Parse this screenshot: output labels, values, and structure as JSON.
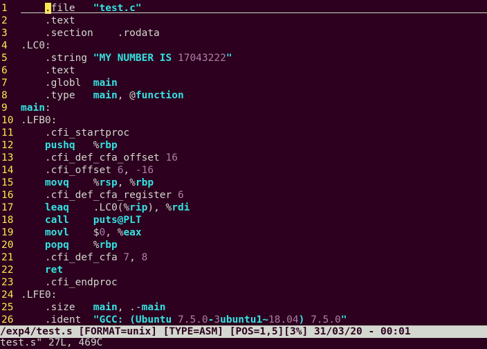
{
  "editor": {
    "lines": [
      {
        "num": "1",
        "segs": [
          {
            "t": "    ",
            "c": "k"
          },
          {
            "t": ".",
            "c": "cursor"
          },
          {
            "t": "file   ",
            "c": "k"
          },
          {
            "t": "\"test.c\"",
            "c": "sq"
          }
        ]
      },
      {
        "num": "2",
        "segs": [
          {
            "t": "    .text",
            "c": "k"
          }
        ]
      },
      {
        "num": "3",
        "segs": [
          {
            "t": "    .section    .rodata",
            "c": "k"
          }
        ]
      },
      {
        "num": "4",
        "segs": [
          {
            "t": ".LC0:",
            "c": "k"
          }
        ]
      },
      {
        "num": "5",
        "segs": [
          {
            "t": "    .string ",
            "c": "k"
          },
          {
            "t": "\"MY NUMBER IS ",
            "c": "sq"
          },
          {
            "t": "17043222",
            "c": "s"
          },
          {
            "t": "\"",
            "c": "sq"
          }
        ]
      },
      {
        "num": "6",
        "segs": [
          {
            "t": "    .text",
            "c": "k"
          }
        ]
      },
      {
        "num": "7",
        "segs": [
          {
            "t": "    .globl  ",
            "c": "k"
          },
          {
            "t": "main",
            "c": "kw"
          }
        ]
      },
      {
        "num": "8",
        "segs": [
          {
            "t": "    .type   ",
            "c": "k"
          },
          {
            "t": "main",
            "c": "kw"
          },
          {
            "t": ", @",
            "c": "k"
          },
          {
            "t": "function",
            "c": "kw"
          }
        ]
      },
      {
        "num": "9",
        "segs": [
          {
            "t": "main",
            "c": "kw"
          },
          {
            "t": ":",
            "c": "k"
          }
        ]
      },
      {
        "num": "10",
        "segs": [
          {
            "t": ".LFB0:",
            "c": "k"
          }
        ]
      },
      {
        "num": "11",
        "segs": [
          {
            "t": "    .cfi_startproc",
            "c": "k"
          }
        ]
      },
      {
        "num": "12",
        "segs": [
          {
            "t": "    ",
            "c": "k"
          },
          {
            "t": "pushq",
            "c": "kw"
          },
          {
            "t": "   %",
            "c": "k"
          },
          {
            "t": "rbp",
            "c": "kw"
          }
        ]
      },
      {
        "num": "13",
        "segs": [
          {
            "t": "    .cfi_def_cfa_offset ",
            "c": "k"
          },
          {
            "t": "16",
            "c": "s"
          }
        ]
      },
      {
        "num": "14",
        "segs": [
          {
            "t": "    .cfi_offset ",
            "c": "k"
          },
          {
            "t": "6",
            "c": "s"
          },
          {
            "t": ", ",
            "c": "k"
          },
          {
            "t": "-16",
            "c": "s"
          }
        ]
      },
      {
        "num": "15",
        "segs": [
          {
            "t": "    ",
            "c": "k"
          },
          {
            "t": "movq",
            "c": "kw"
          },
          {
            "t": "    %",
            "c": "k"
          },
          {
            "t": "rsp",
            "c": "kw"
          },
          {
            "t": ", %",
            "c": "k"
          },
          {
            "t": "rbp",
            "c": "kw"
          }
        ]
      },
      {
        "num": "16",
        "segs": [
          {
            "t": "    .cfi_def_cfa_register ",
            "c": "k"
          },
          {
            "t": "6",
            "c": "s"
          }
        ]
      },
      {
        "num": "17",
        "segs": [
          {
            "t": "    ",
            "c": "k"
          },
          {
            "t": "leaq",
            "c": "kw"
          },
          {
            "t": "    .LC0(%",
            "c": "k"
          },
          {
            "t": "rip",
            "c": "kw"
          },
          {
            "t": "), %",
            "c": "k"
          },
          {
            "t": "rdi",
            "c": "kw"
          }
        ]
      },
      {
        "num": "18",
        "segs": [
          {
            "t": "    ",
            "c": "k"
          },
          {
            "t": "call",
            "c": "kw"
          },
          {
            "t": "    ",
            "c": "k"
          },
          {
            "t": "puts@PLT",
            "c": "kw"
          }
        ]
      },
      {
        "num": "19",
        "segs": [
          {
            "t": "    ",
            "c": "k"
          },
          {
            "t": "movl",
            "c": "kw"
          },
          {
            "t": "    $",
            "c": "k"
          },
          {
            "t": "0",
            "c": "s"
          },
          {
            "t": ", %",
            "c": "k"
          },
          {
            "t": "eax",
            "c": "kw"
          }
        ]
      },
      {
        "num": "20",
        "segs": [
          {
            "t": "    ",
            "c": "k"
          },
          {
            "t": "popq",
            "c": "kw"
          },
          {
            "t": "    %",
            "c": "k"
          },
          {
            "t": "rbp",
            "c": "kw"
          }
        ]
      },
      {
        "num": "21",
        "segs": [
          {
            "t": "    .cfi_def_cfa ",
            "c": "k"
          },
          {
            "t": "7",
            "c": "s"
          },
          {
            "t": ", ",
            "c": "k"
          },
          {
            "t": "8",
            "c": "s"
          }
        ]
      },
      {
        "num": "22",
        "segs": [
          {
            "t": "    ",
            "c": "k"
          },
          {
            "t": "ret",
            "c": "kw"
          }
        ]
      },
      {
        "num": "23",
        "segs": [
          {
            "t": "    .cfi_endproc",
            "c": "k"
          }
        ]
      },
      {
        "num": "24",
        "segs": [
          {
            "t": ".LFE0:",
            "c": "k"
          }
        ]
      },
      {
        "num": "25",
        "segs": [
          {
            "t": "    .size   ",
            "c": "k"
          },
          {
            "t": "main",
            "c": "kw"
          },
          {
            "t": ", .-",
            "c": "k"
          },
          {
            "t": "main",
            "c": "kw"
          }
        ]
      },
      {
        "num": "26",
        "segs": [
          {
            "t": "    .ident  ",
            "c": "k"
          },
          {
            "t": "\"GCC: (",
            "c": "sq"
          },
          {
            "t": "Ubuntu ",
            "c": "kw"
          },
          {
            "t": "7.5.0",
            "c": "s"
          },
          {
            "t": "-",
            "c": "sq"
          },
          {
            "t": "3",
            "c": "s"
          },
          {
            "t": "ubuntu1",
            "c": "kw"
          },
          {
            "t": "~",
            "c": "sq"
          },
          {
            "t": "18.04",
            "c": "s"
          },
          {
            "t": ") ",
            "c": "sq"
          },
          {
            "t": "7.5.0",
            "c": "s"
          },
          {
            "t": "\"",
            "c": "sq"
          }
        ]
      }
    ]
  },
  "statusline": {
    "text": "/exp4/test.s [FORMAT=unix] [TYPE=ASM] [POS=1,5][3%] 31/03/20 - 00:01"
  },
  "cmdline": {
    "text": "test.s\" 27L, 469C"
  },
  "colors": {
    "background": "#2c001e",
    "foreground": "#d3d7cf",
    "line_number": "#fce94f",
    "keyword": "#34e2e2",
    "constant": "#ad7fa8",
    "status_bg": "#d3d7cf"
  }
}
